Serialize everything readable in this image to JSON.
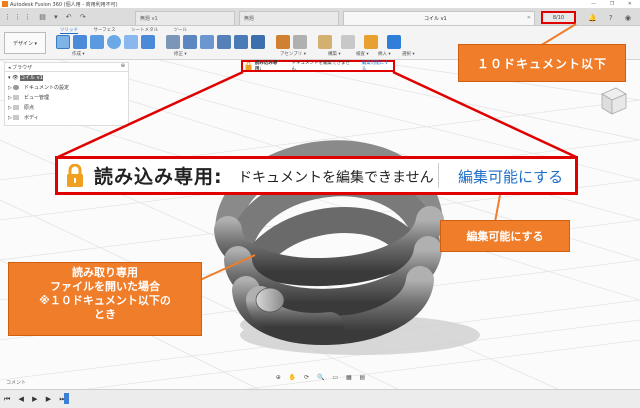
{
  "app": {
    "title": "Autodesk Fusion 360 (個人用 - 商用利用不可)",
    "window_controls": "— ❐ ✕"
  },
  "tabbar": {
    "quick_access": "⋮⋮⋮ ▤ ▾ ↶ ↷",
    "tabs": [
      {
        "label": "無題 v1",
        "active": false
      },
      {
        "label": "無題",
        "active": false
      },
      {
        "label": "コイル v1",
        "active": true
      }
    ],
    "right_icons": "＋ ◷ 🔔 ? ◉",
    "document_count": "8/10"
  },
  "ribbon": {
    "design_label": "デザイン ▾",
    "tabs": [
      "ソリッド",
      "サーフェス",
      "シートメタル",
      "ツール"
    ],
    "groups": [
      "作成 ▾",
      "修正 ▾",
      "アセンブリ ▾",
      "構築 ▾",
      "検査 ▾",
      "挿入 ▾",
      "選択 ▾"
    ]
  },
  "browser": {
    "header": "ブラウザ",
    "root": "コイル v1",
    "items": [
      "ドキュメントの設定",
      "ビュー管理",
      "原点",
      "ボディ"
    ]
  },
  "readonly_bar_small": {
    "title": "読み込み専用:",
    "message": "ドキュメントを編集できません",
    "link": "編集可能にする"
  },
  "readonly_bar_large": {
    "title": "読み込み専用:",
    "message": "ドキュメントを編集できません",
    "link": "編集可能にする"
  },
  "callouts": {
    "doc_limit": "１０ドキュメント以下",
    "make_editable": "編集可能にする",
    "readonly_case": [
      "読み取り専用",
      "ファイルを開いた場合",
      "※１０ドキュメント以下の",
      "とき"
    ]
  },
  "comment": {
    "label": "コメント"
  },
  "navbar": {
    "icons": "⊕ ✋ ⟳ 🔍 ▭ ▦ ▤"
  },
  "timeline": {
    "controls": "⏮ ◀ ▶ ▶ ⏭"
  },
  "colors": {
    "accent": "#1e6ec8",
    "highlight": "#e00000",
    "callout": "#f07d2a"
  }
}
